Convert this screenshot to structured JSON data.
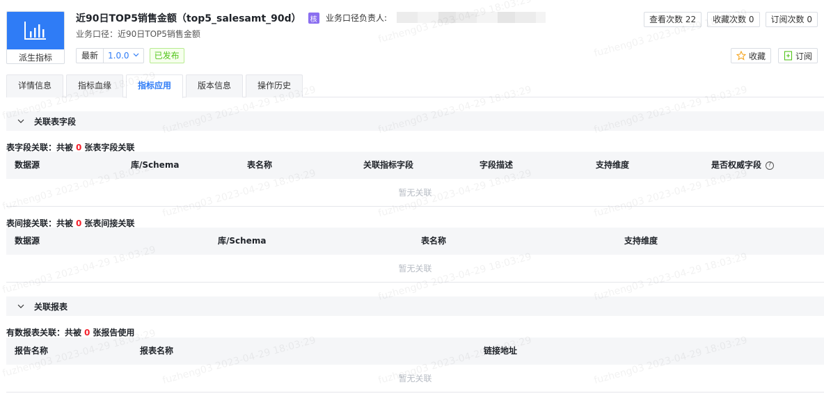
{
  "header": {
    "logo_label": "派生指标",
    "title": "近90日TOP5销售金额（top5_salesamt_90d）",
    "core_badge": "核",
    "owner_label": "业务口径负责人:",
    "biz_caliber": "业务口径：近90日TOP5销售金额",
    "version_latest": "最新",
    "version_value": "1.0.0",
    "status": "已发布",
    "stats": {
      "views": "查看次数 22",
      "favorites": "收藏次数 0",
      "subscriptions": "订阅次数 0"
    },
    "favorite_btn": "收藏",
    "subscribe_btn": "订阅"
  },
  "tabs": [
    "详情信息",
    "指标血缘",
    "指标应用",
    "版本信息",
    "操作历史"
  ],
  "active_tab": "指标应用",
  "section_fields": {
    "title": "关联表字段",
    "direct": {
      "prefix": "表字段关联：共被",
      "count": "0",
      "suffix": "张表字段关联",
      "columns": [
        "数据源",
        "库/Schema",
        "表名称",
        "关联指标字段",
        "字段描述",
        "支持维度",
        "是否权威字段"
      ],
      "empty": "暂无关联"
    },
    "indirect": {
      "prefix": "表间接关联：共被",
      "count": "0",
      "suffix": "张表间接关联",
      "columns": [
        "数据源",
        "库/Schema",
        "表名称",
        "支持维度"
      ],
      "empty": "暂无关联"
    }
  },
  "section_reports": {
    "title": "关联报表",
    "summary": {
      "prefix": "有数报表关联：共被",
      "count": "0",
      "suffix": "张报告使用",
      "columns": [
        "报告名称",
        "报表名称",
        "链接地址"
      ],
      "empty": "暂无关联"
    }
  },
  "watermark": "fuzheng03 2023-04-29 18:03:29",
  "colors": {
    "accent": "#2f7cf6",
    "badge": "#8b6ff0",
    "success": "#52c41a",
    "count": "#f5222d"
  }
}
